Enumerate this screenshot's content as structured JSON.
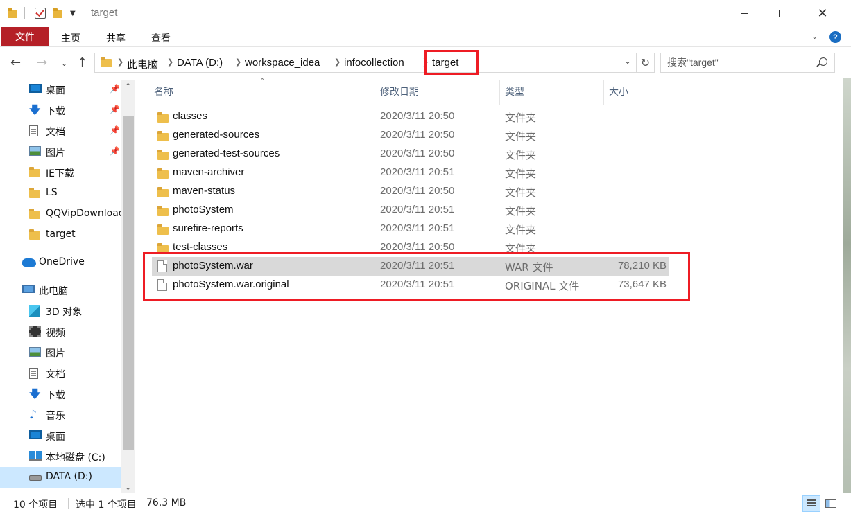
{
  "window": {
    "title": "target",
    "controls": [
      "minimize",
      "maximize",
      "close"
    ]
  },
  "ribbon": {
    "tabs": [
      "文件",
      "主页",
      "共享",
      "查看"
    ]
  },
  "address": {
    "crumbs": [
      "此电脑",
      "DATA (D:)",
      "workspace_idea",
      "infocollection",
      "target"
    ]
  },
  "search": {
    "placeholder": "搜索\"target\""
  },
  "nav": {
    "items": [
      {
        "label": "桌面",
        "icon": "desktop-icon",
        "pinned": true
      },
      {
        "label": "下载",
        "icon": "download-icon",
        "pinned": true
      },
      {
        "label": "文档",
        "icon": "document-icon",
        "pinned": true
      },
      {
        "label": "图片",
        "icon": "pictures-icon",
        "pinned": true
      },
      {
        "label": "IE下载",
        "icon": "folder-icon",
        "pinned": false
      },
      {
        "label": "LS",
        "icon": "folder-icon",
        "pinned": false
      },
      {
        "label": "QQVipDownload",
        "icon": "folder-icon",
        "pinned": false
      },
      {
        "label": "target",
        "icon": "folder-icon",
        "pinned": false
      },
      {
        "label": "OneDrive",
        "icon": "onedrive-icon",
        "pinned": false
      },
      {
        "label": "此电脑",
        "icon": "this-pc-icon",
        "pinned": false
      },
      {
        "label": "3D 对象",
        "icon": "3d-objects-icon",
        "pinned": false
      },
      {
        "label": "视频",
        "icon": "videos-icon",
        "pinned": false
      },
      {
        "label": "图片",
        "icon": "pictures-icon",
        "pinned": false
      },
      {
        "label": "文档",
        "icon": "document-icon",
        "pinned": false
      },
      {
        "label": "下载",
        "icon": "download-icon",
        "pinned": false
      },
      {
        "label": "音乐",
        "icon": "music-icon",
        "pinned": false
      },
      {
        "label": "桌面",
        "icon": "desktop-icon",
        "pinned": false
      },
      {
        "label": "本地磁盘 (C:)",
        "icon": "windows-drive-icon",
        "pinned": false
      },
      {
        "label": "DATA (D:)",
        "icon": "drive-icon",
        "pinned": false,
        "selected": true
      }
    ]
  },
  "columns": {
    "name": "名称",
    "modified": "修改日期",
    "type": "类型",
    "size": "大小"
  },
  "files": [
    {
      "name": "classes",
      "date": "2020/3/11 20:50",
      "type": "文件夹",
      "size": "",
      "kind": "folder"
    },
    {
      "name": "generated-sources",
      "date": "2020/3/11 20:50",
      "type": "文件夹",
      "size": "",
      "kind": "folder"
    },
    {
      "name": "generated-test-sources",
      "date": "2020/3/11 20:50",
      "type": "文件夹",
      "size": "",
      "kind": "folder"
    },
    {
      "name": "maven-archiver",
      "date": "2020/3/11 20:51",
      "type": "文件夹",
      "size": "",
      "kind": "folder"
    },
    {
      "name": "maven-status",
      "date": "2020/3/11 20:50",
      "type": "文件夹",
      "size": "",
      "kind": "folder"
    },
    {
      "name": "photoSystem",
      "date": "2020/3/11 20:51",
      "type": "文件夹",
      "size": "",
      "kind": "folder"
    },
    {
      "name": "surefire-reports",
      "date": "2020/3/11 20:51",
      "type": "文件夹",
      "size": "",
      "kind": "folder"
    },
    {
      "name": "test-classes",
      "date": "2020/3/11 20:50",
      "type": "文件夹",
      "size": "",
      "kind": "folder"
    },
    {
      "name": "photoSystem.war",
      "date": "2020/3/11 20:51",
      "type": "WAR 文件",
      "size": "78,210 KB",
      "kind": "file",
      "selected": true
    },
    {
      "name": "photoSystem.war.original",
      "date": "2020/3/11 20:51",
      "type": "ORIGINAL 文件",
      "size": "73,647 KB",
      "kind": "file"
    }
  ],
  "status": {
    "count": "10 个项目",
    "selection": "选中 1 个项目",
    "selection_size": "76.3 MB"
  },
  "colors": {
    "file_tab": "#b52027",
    "selection": "#cce8ff",
    "highlight_box": "#ee1c24"
  }
}
